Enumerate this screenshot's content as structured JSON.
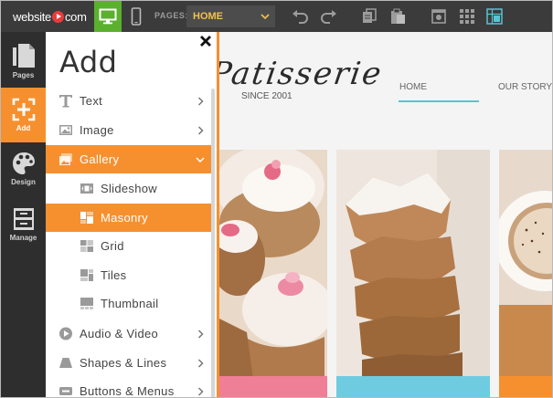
{
  "topbar": {
    "logo_text": "website",
    "logo_suffix": "com",
    "pages_label": "PAGES:",
    "page_value": "HOME",
    "accent_green": "#5bb02e",
    "select_color": "#f2c14e",
    "icons": [
      "desktop-view-icon",
      "mobile-view-icon",
      "undo-icon",
      "redo-icon",
      "copy-icon",
      "paste-icon",
      "preview-icon",
      "grid-icon",
      "snap-grid-icon"
    ]
  },
  "leftnav": {
    "items": [
      {
        "label": "Pages",
        "icon": "pages-icon"
      },
      {
        "label": "Add",
        "icon": "add-icon"
      },
      {
        "label": "Design",
        "icon": "palette-icon"
      },
      {
        "label": "Manage",
        "icon": "manage-icon"
      }
    ],
    "active_color": "#f6902f"
  },
  "panel": {
    "title": "Add",
    "items": [
      {
        "label": "Text",
        "icon": "text-icon"
      },
      {
        "label": "Image",
        "icon": "image-icon"
      },
      {
        "label": "Gallery",
        "icon": "gallery-icon"
      },
      {
        "label": "Slideshow",
        "icon": "slideshow-icon"
      },
      {
        "label": "Masonry",
        "icon": "masonry-icon"
      },
      {
        "label": "Grid",
        "icon": "grid-layout-icon"
      },
      {
        "label": "Tiles",
        "icon": "tiles-icon"
      },
      {
        "label": "Thumbnail",
        "icon": "thumbnail-icon"
      },
      {
        "label": "Audio & Video",
        "icon": "play-icon"
      },
      {
        "label": "Shapes & Lines",
        "icon": "shape-icon"
      },
      {
        "label": "Buttons & Menus",
        "icon": "button-icon"
      }
    ]
  },
  "site": {
    "brand": "Patisserie",
    "since": "SINCE 2001",
    "nav": [
      "HOME",
      "OUR STORY"
    ],
    "accent_teal": "#59c3d4"
  }
}
